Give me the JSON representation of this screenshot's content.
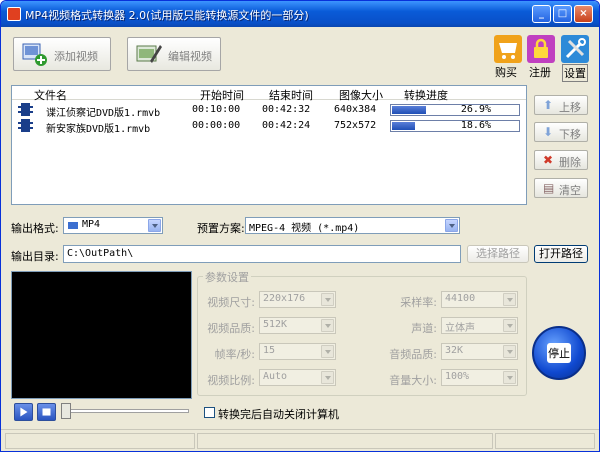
{
  "window": {
    "title": "MP4视频格式转换器 2.0(试用版只能转换源文件的一部分)",
    "controls": [
      "_",
      "□",
      "×"
    ]
  },
  "toolbar": {
    "add_video": "添加视频",
    "edit_video": "编辑视频",
    "buy": "购买",
    "register": "注册",
    "settings": "设置"
  },
  "file_list": {
    "columns": [
      "文件名",
      "开始时间",
      "结束时间",
      "图像大小",
      "转换进度"
    ],
    "rows": [
      {
        "name": "谍江侦察记DVD版1.rmvb",
        "start": "00:10:00",
        "end": "00:42:32",
        "size": "640x384",
        "progress_text": "26.9%",
        "progress": 0.269
      },
      {
        "name": "新安家族DVD版1.rmvb",
        "start": "00:00:00",
        "end": "00:42:24",
        "size": "752x572",
        "progress_text": "18.6%",
        "progress": 0.186
      }
    ]
  },
  "side_buttons": {
    "move_up": "上移",
    "move_down": "下移",
    "delete": "删除",
    "clear": "清空"
  },
  "output": {
    "format_label": "输出格式:",
    "format_value": "MP4",
    "preset_label": "预置方案:",
    "preset_value": "MPEG-4 视频 (*.mp4)",
    "dir_label": "输出目录:",
    "dir_value": "C:\\OutPath\\",
    "browse": "选择路径",
    "open": "打开路径"
  },
  "params": {
    "title": "参数设置",
    "video_size_label": "视频尺寸:",
    "video_size": "220x176",
    "video_quality_label": "视频品质:",
    "video_quality": "512K",
    "fps_label": "帧率/秒:",
    "fps": "15",
    "aspect_label": "视频比例:",
    "aspect": "Auto",
    "sample_rate_label": "采样率:",
    "sample_rate": "44100",
    "channel_label": "声道:",
    "channel": "立体声",
    "audio_quality_label": "音频品质:",
    "audio_quality": "32K",
    "volume_label": "音量大小:",
    "volume": "100%"
  },
  "stop": "停止",
  "shutdown_after": "转换完后自动关闭计算机",
  "colors": {
    "titlebar": "#0a5bd8",
    "progress": "#1f4fb6",
    "panel": "#ece9d8"
  }
}
